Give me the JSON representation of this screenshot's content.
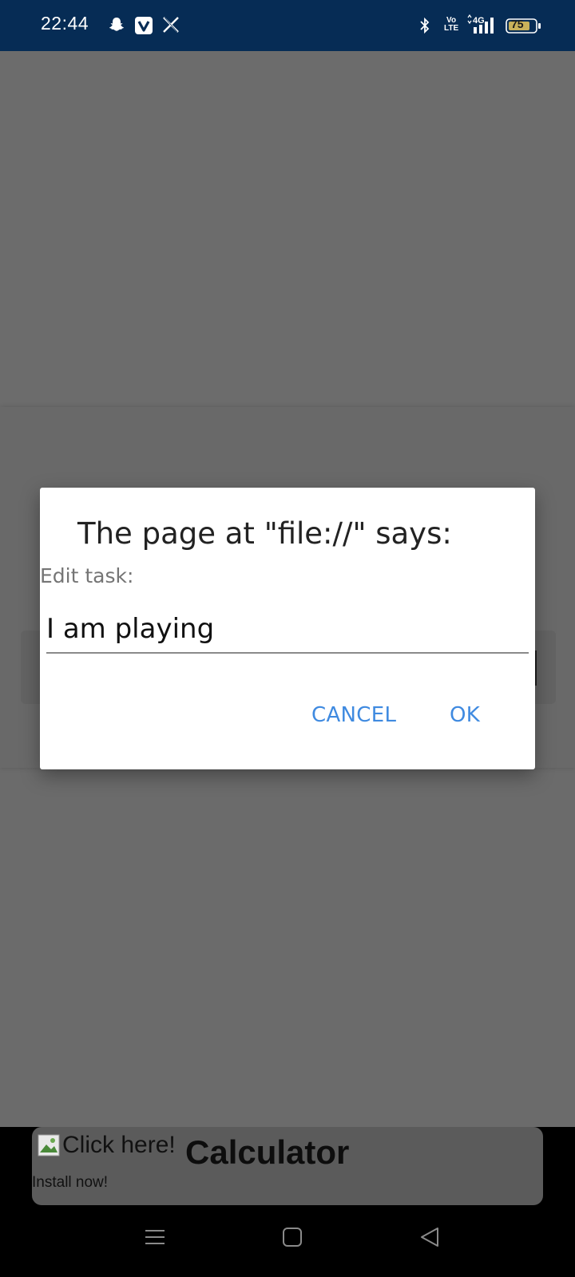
{
  "status_bar": {
    "time": "22:44",
    "left_icons": [
      "snapchat-icon",
      "v-app-icon",
      "x-icon"
    ],
    "volte_line1": "Vo",
    "volte_line2": "LTE",
    "network": "4G",
    "battery": "75"
  },
  "dialog": {
    "title": "The page at \"file://\" says:",
    "message": "Edit task:",
    "input_value": "I am playing",
    "cancel_label": "CANCEL",
    "ok_label": "OK",
    "accent_color": "#3f8ae0"
  },
  "ad": {
    "image_alt": "Click here!",
    "title": "Calculator",
    "subtitle": "Install now!"
  },
  "nav_bar": {
    "icons": [
      "menu-icon",
      "home-icon",
      "back-icon"
    ]
  }
}
